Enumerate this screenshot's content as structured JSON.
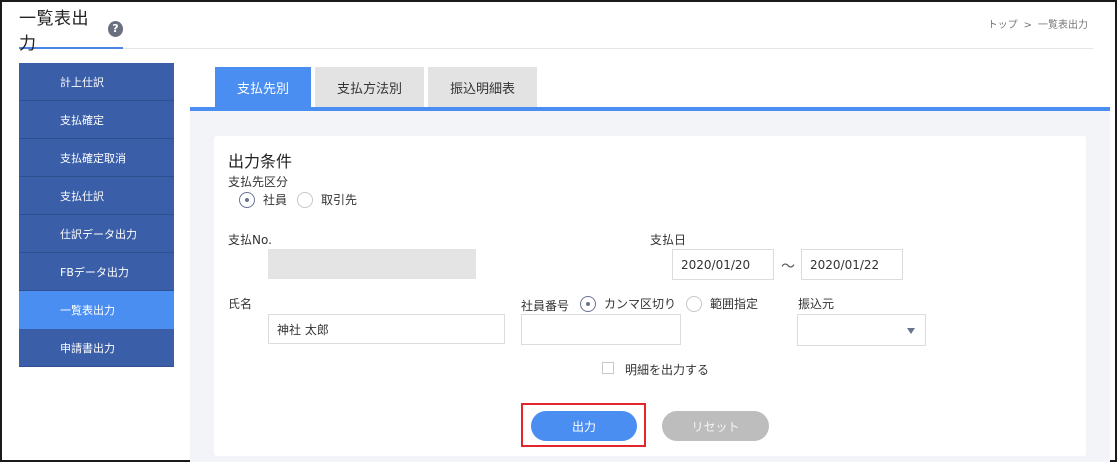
{
  "header": {
    "title": "一覧表出力",
    "help_icon": "?",
    "breadcrumb": {
      "home": "トップ",
      "separator": ">",
      "current": "一覧表出力"
    }
  },
  "sidebar": {
    "items": [
      {
        "label": "計上仕訳"
      },
      {
        "label": "支払確定"
      },
      {
        "label": "支払確定取消"
      },
      {
        "label": "支払仕訳"
      },
      {
        "label": "仕訳データ出力"
      },
      {
        "label": "FBデータ出力"
      },
      {
        "label": "一覧表出力",
        "active": true
      },
      {
        "label": "申請書出力"
      }
    ]
  },
  "tabs": [
    {
      "label": "支払先別",
      "active": true
    },
    {
      "label": "支払方法別"
    },
    {
      "label": "振込明細表"
    }
  ],
  "form": {
    "section_title": "出力条件",
    "payee_type": {
      "label": "支払先区分",
      "options": [
        {
          "label": "社員",
          "checked": true
        },
        {
          "label": "取引先",
          "checked": false
        }
      ]
    },
    "payment_no": {
      "label": "支払No.",
      "value": ""
    },
    "payment_date": {
      "label": "支払日",
      "from": "2020/01/20",
      "separator": "～",
      "to": "2020/01/22"
    },
    "name": {
      "label": "氏名",
      "value": "神社 太郎"
    },
    "employee_no": {
      "label": "社員番号",
      "options": [
        {
          "label": "カンマ区切り",
          "checked": true
        },
        {
          "label": "範囲指定",
          "checked": false
        }
      ],
      "value": ""
    },
    "transfer_source": {
      "label": "振込元",
      "value": ""
    },
    "detail_checkbox": {
      "label": "明細を出力する",
      "checked": false
    }
  },
  "buttons": {
    "output": "出力",
    "reset": "リセット"
  },
  "colors": {
    "accent": "#4a8ef2",
    "sidebar": "#3a5ea8",
    "highlight": "#e3262b"
  }
}
